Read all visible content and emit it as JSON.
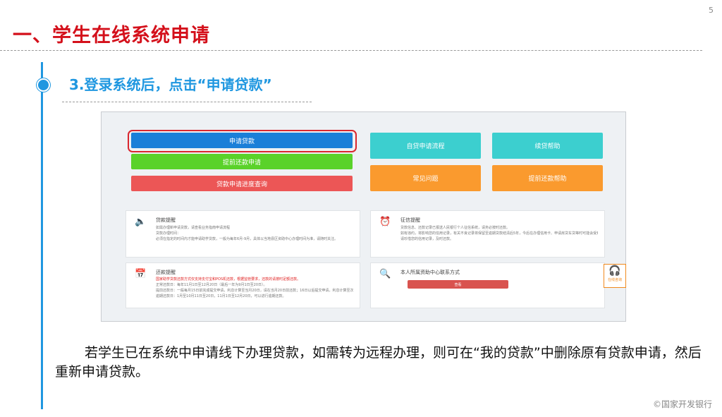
{
  "slide": {
    "page_number": "5",
    "title": "一、学生在线系统申请",
    "step": "3.登录系统后，点击“申请贷款”",
    "paragraph": "若学生已在系统中申请线下办理贷款，如需转为远程办理，则可在“我的贷款”中删除原有贷款申请，然后重新申请贷款。",
    "copyright": "©国家开发银行"
  },
  "screenshot": {
    "buttons": {
      "apply": "申请贷款",
      "prepay": "提前还款申请",
      "query": "贷款申请进度查询",
      "flow": "自贷申请流程",
      "help1": "续贷帮助",
      "faq": "常见问题",
      "help2": "提前还款帮助"
    },
    "cards": {
      "loan_notice": {
        "title": "贷款提醒",
        "lines": [
          "如需办理新申请贷款，请查看业务指南申请流程",
          "贷款办理时间：",
          "必须在指定的时间内才能申请助学贷款，一般为每年6月-9月，具体以当地县区资助中心办理时间为准，请随时关注。"
        ]
      },
      "credit_notice": {
        "title": "征信提醒",
        "lines": [
          "贷款信息、还款记录已报送人民银行个人征信系统，请务必按时还款。",
          "如有违约，将影响您的信用记录，有关不良记录将保留至逾期贷款结清后5年，今后在办理信用卡、申请房贷车贷等时可能会受到影响。",
          "请珍惜您的信用记录，及时还款。"
        ]
      },
      "repay_notice": {
        "title": "还款提醒",
        "red_line": "国家助学贷款还款方式仅支持支付宝和POS机还款，根据监管要求，还款的请按时足额还款。",
        "lines": [
          "正常还款日：每年11月1日至12月20日（最后一年为9月1日至20日）。",
          "提前还款日：一般每月15日前完成提交申请，利息计算至当月20日，请在当月20日前还款；16日以后提交申请，利息计算至次月20日，请于次月20日前还款。",
          "逾期还款日：1月至10月11日至20日，11月1日至12月20日，可以进行逾期还款。"
        ]
      },
      "contact": {
        "title": "本人所属资助中心联系方式",
        "button": "查看"
      }
    },
    "service_label": "在线咨询"
  },
  "colors": {
    "title_red": "#d4101b",
    "accent_blue": "#1f97e0"
  },
  "icons": {
    "speaker": "speaker-icon",
    "alarm": "alarm-clock-icon",
    "calendar": "calendar-icon",
    "search": "search-icon",
    "headset": "headset-icon"
  }
}
